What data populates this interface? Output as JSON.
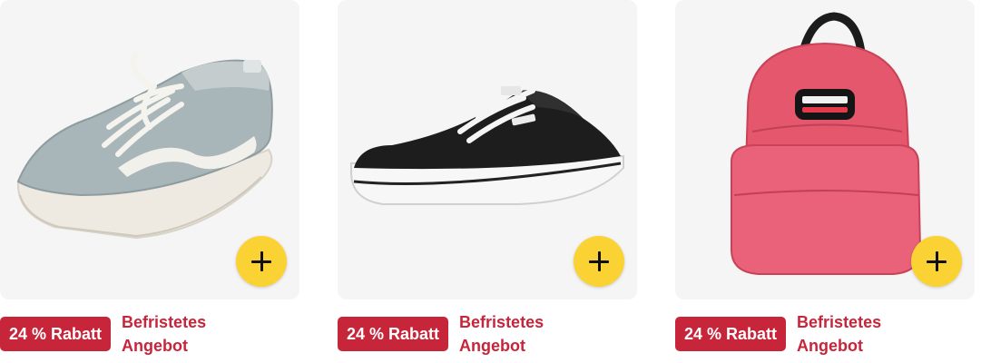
{
  "products": [
    {
      "image": "grey-canvas-sneaker",
      "add_icon": "plus-icon",
      "discount_badge": "24 % Rabatt",
      "deal_label": "Befristetes Angebot"
    },
    {
      "image": "black-canvas-sneaker",
      "add_icon": "plus-icon",
      "discount_badge": "24 % Rabatt",
      "deal_label": "Befristetes Angebot"
    },
    {
      "image": "pink-backpack",
      "add_icon": "plus-icon",
      "discount_badge": "24 % Rabatt",
      "deal_label": "Befristetes Angebot"
    }
  ],
  "colors": {
    "badge_background": "#c7253a",
    "deal_text": "#c7253a",
    "add_button": "#fad233",
    "card_background": "#f5f5f5"
  }
}
